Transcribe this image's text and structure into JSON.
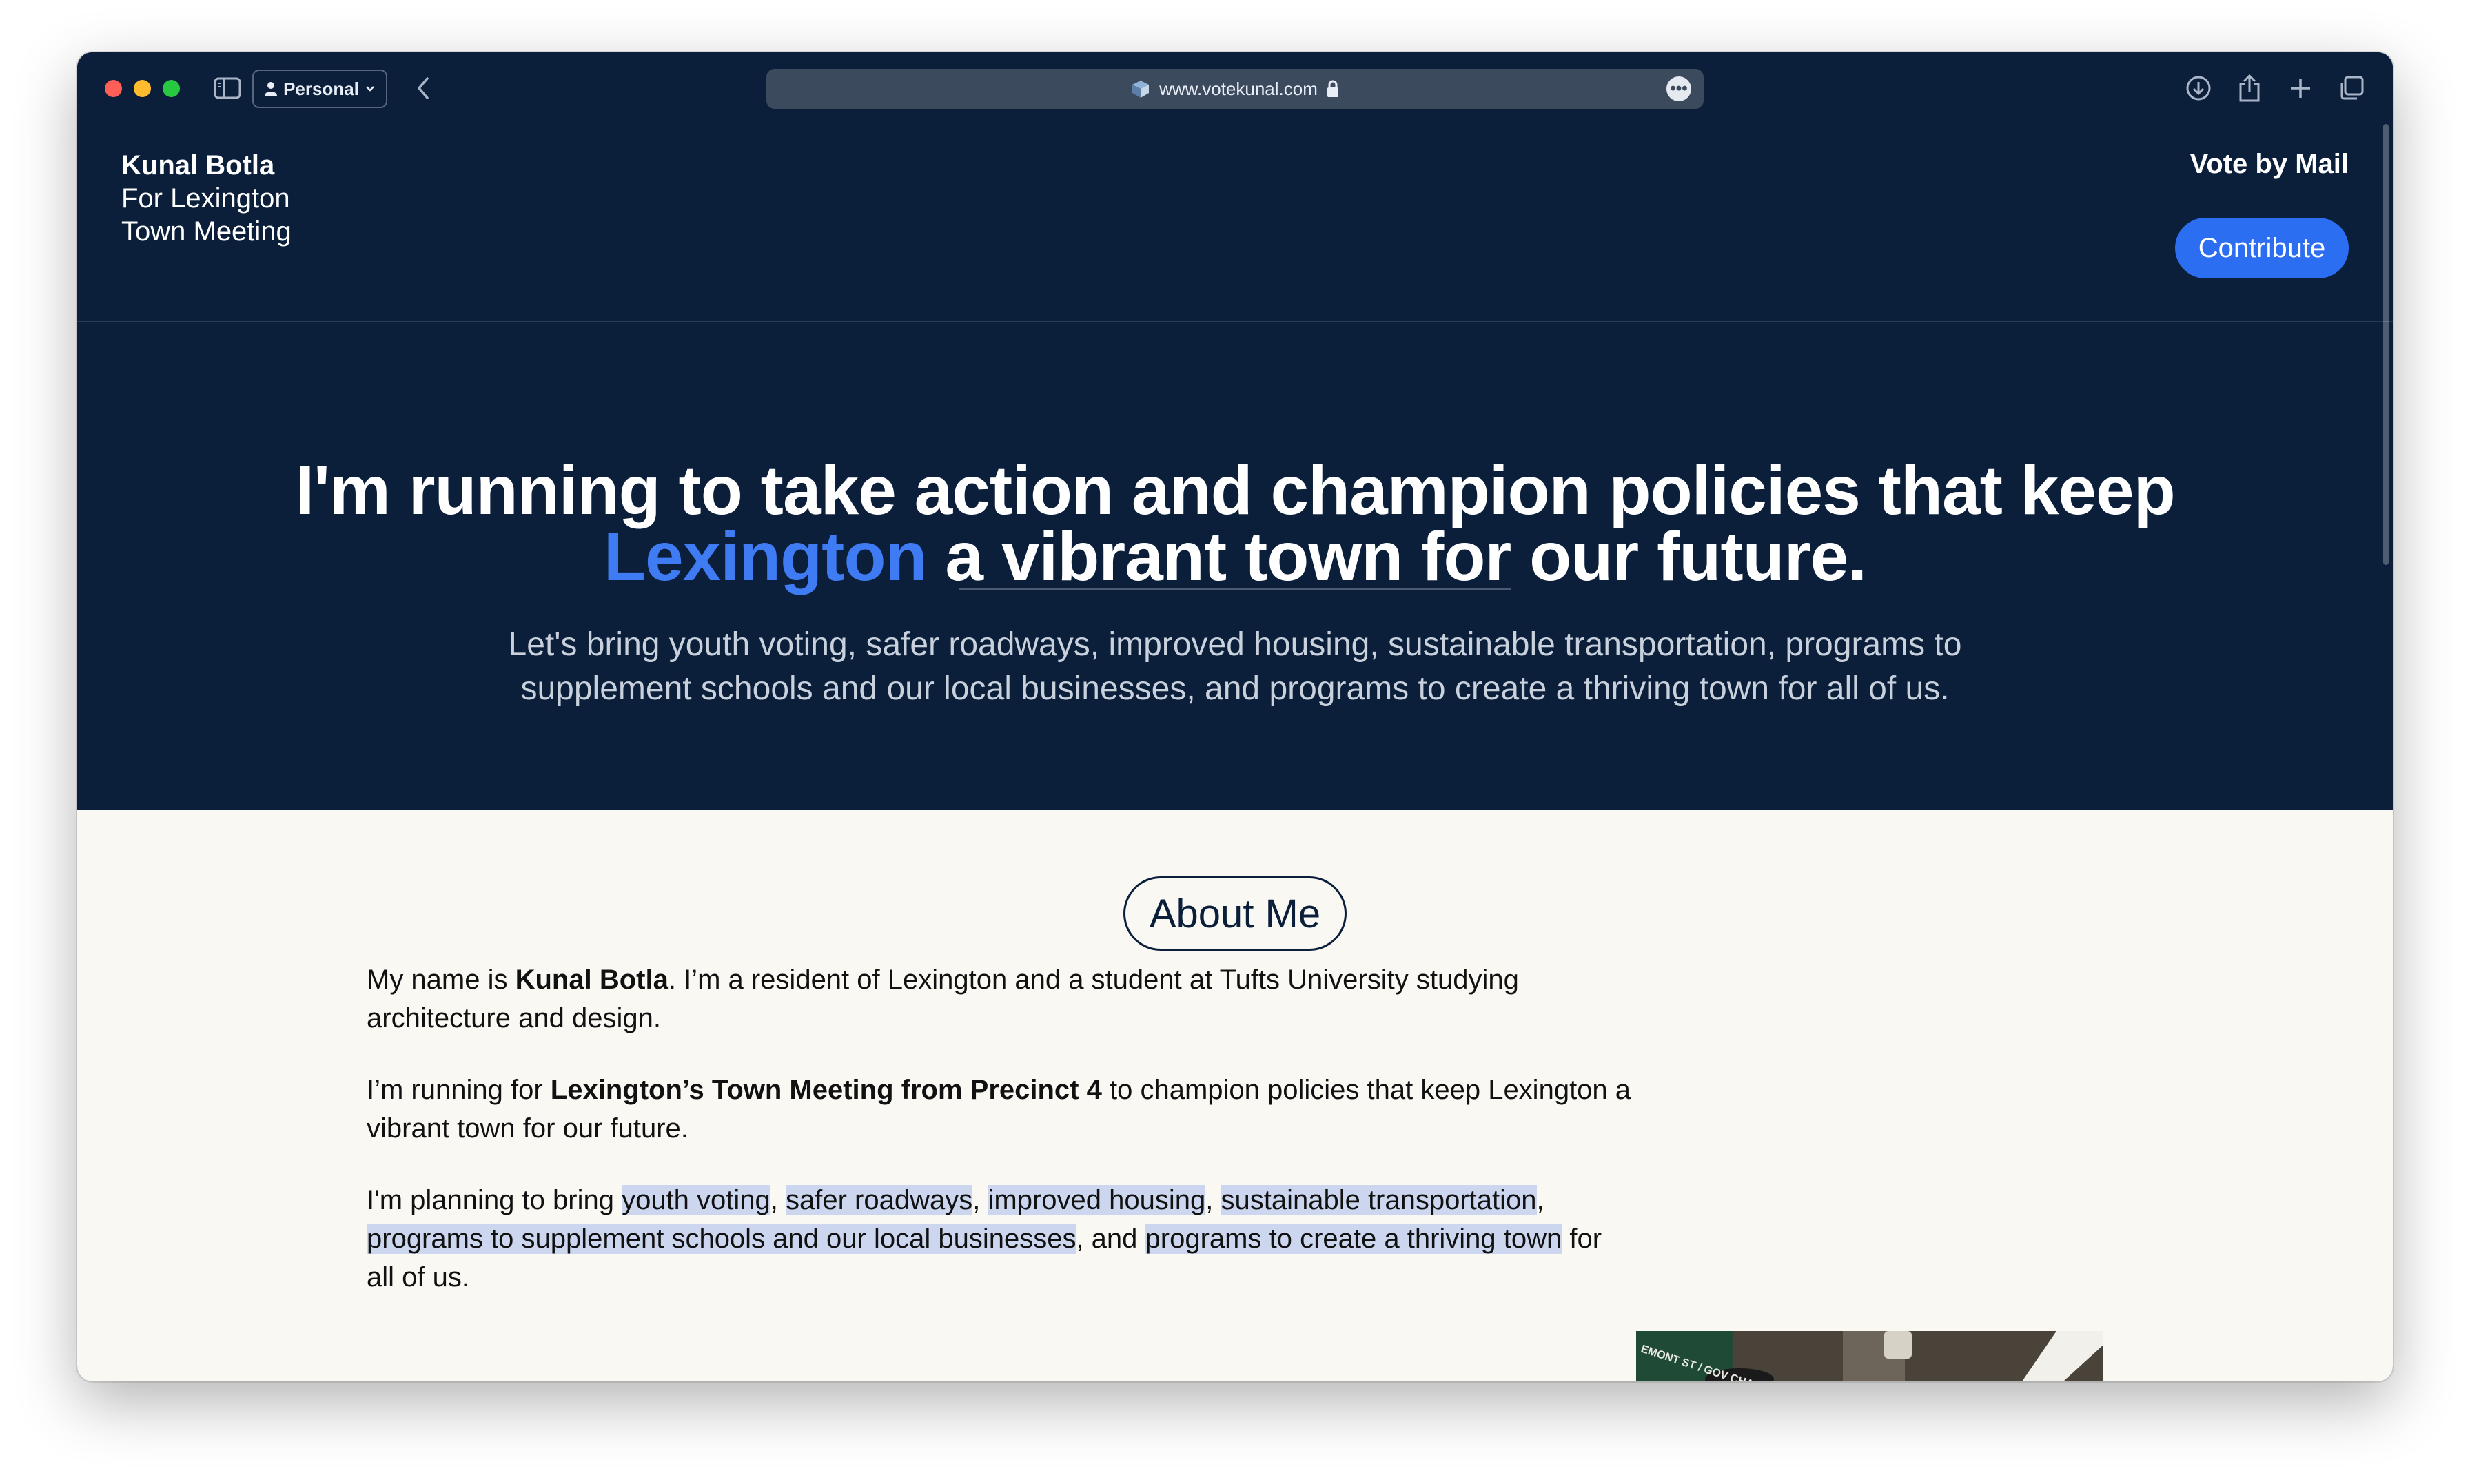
{
  "browser": {
    "profile_label": "Personal",
    "url": "www.votekunal.com"
  },
  "header": {
    "brand_name": "Kunal Botla",
    "brand_line2": "For Lexington",
    "brand_line3": "Town Meeting",
    "vote_link": "Vote by Mail",
    "contribute_label": "Contribute"
  },
  "hero": {
    "headline_part1": "I'm running to take action and champion policies that keep ",
    "headline_accent": "Lexington",
    "headline_part2": " a vibrant town for our future.",
    "subtext": "Let's bring youth voting, safer roadways, improved housing, sustainable transportation, programs to supplement schools and our local businesses, and programs to create a thriving town for all of us."
  },
  "about": {
    "title": "About Me",
    "p1": {
      "a": "My name is ",
      "bold": "Kunal Botla",
      "b": ". I’m a resident of Lexington and a student at Tufts University studying architecture and design."
    },
    "p2": {
      "a": "I’m running for ",
      "bold": "Lexington’s Town Meeting from Precinct 4",
      "b": " to champion policies that keep Lexington a vibrant town for our future."
    },
    "p3": {
      "a": "I'm planning to bring ",
      "h1": "youth voting",
      "s1": ", ",
      "h2": "safer roadways",
      "s2": ", ",
      "h3": "improved housing",
      "s3": ", ",
      "h4": "sustainable transportation",
      "s4": ", ",
      "h5": "programs to supplement schools and our local businesses",
      "s5": ", and ",
      "h6": "programs to create a thriving town",
      "s6": " for all of us."
    }
  },
  "photo": {
    "sign_text": "EMONT ST / GOV CHA"
  },
  "colors": {
    "navy": "#0b1f3b",
    "accent_blue": "#3f7cf3",
    "button_blue": "#2c6ef2",
    "cream": "#f9f8f3",
    "highlight": "#ccd7ef"
  }
}
